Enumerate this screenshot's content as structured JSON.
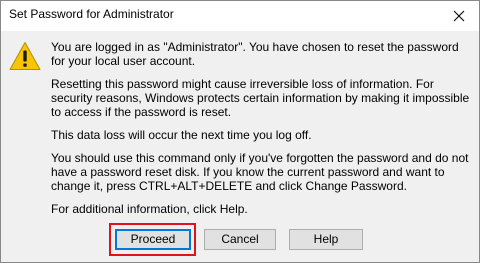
{
  "window": {
    "title": "Set Password for Administrator",
    "close_icon": "close-icon"
  },
  "dialog": {
    "icon": "warning-icon",
    "paragraphs": [
      "You are logged in as \"Administrator\". You have chosen to reset the password for your local user account.",
      "Resetting this password might cause irreversible loss of information. For security reasons, Windows protects certain information by making it impossible to access if the password is reset.",
      "This data loss will occur the next time you log off.",
      "You should use this command only if you've forgotten the password and do not have a password reset disk. If you know the current password and want to change it, press CTRL+ALT+DELETE and click Change Password.",
      "For additional information, click Help."
    ]
  },
  "buttons": {
    "proceed": "Proceed",
    "cancel": "Cancel",
    "help": "Help"
  },
  "colors": {
    "highlight": "#e0131d",
    "focus_border": "#0078d7",
    "warning_yellow": "#f7c600"
  }
}
